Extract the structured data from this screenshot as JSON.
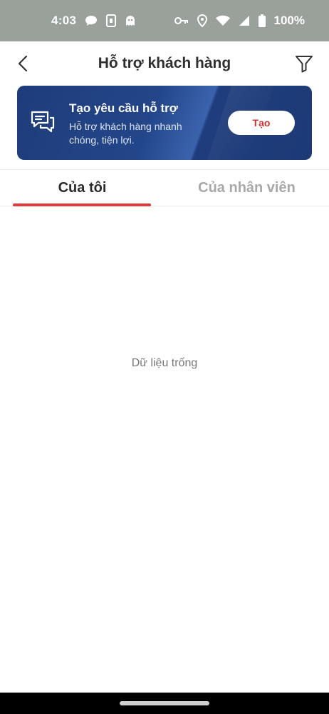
{
  "status_bar": {
    "time": "4:03",
    "battery": "100%",
    "left_icons": [
      "chat-bubble-icon",
      "sim-card-icon",
      "ghost-icon"
    ],
    "right_icons": [
      "key-icon",
      "location-pin-icon",
      "wifi-icon",
      "signal-icon",
      "battery-icon"
    ]
  },
  "header": {
    "title": "Hỗ trợ khách hàng",
    "back_icon": "chevron-left-icon",
    "filter_icon": "filter-icon"
  },
  "banner": {
    "title": "Tạo yêu cầu hỗ trợ",
    "subtitle": "Hỗ trợ khách hàng nhanh chóng, tiện lợi.",
    "button_label": "Tạo",
    "icon": "chat-bubbles-icon",
    "accent_color": "#1e3c7a"
  },
  "tabs": [
    {
      "label": "Của tôi",
      "active": true
    },
    {
      "label": "Của nhân viên",
      "active": false
    }
  ],
  "empty_state": {
    "message": "Dữ liệu trống"
  },
  "colors": {
    "status_bar": "#9aa09a",
    "tab_indicator": "#e03a3a",
    "button_text": "#d32f2f"
  }
}
